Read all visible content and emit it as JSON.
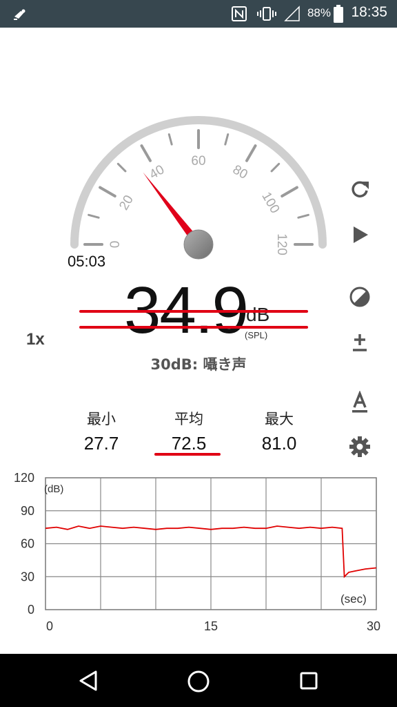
{
  "status_bar": {
    "time": "18:35",
    "battery_percent": "88%",
    "icons": [
      "app-notification-icon",
      "nfc-icon",
      "vibrate-icon",
      "signal-icon",
      "battery-icon"
    ]
  },
  "meter": {
    "gauge_labels": [
      "0",
      "20",
      "40",
      "60",
      "80",
      "100",
      "120"
    ],
    "needle_value": 34.9,
    "elapsed_time": "05:03",
    "reading": "34.9",
    "unit": "dB",
    "unit_sub": "(SPL)",
    "multiplier": "1x",
    "reference": "30dB: 囁き声"
  },
  "stats": {
    "min_label": "最小",
    "min_value": "27.7",
    "avg_label": "平均",
    "avg_value": "72.5",
    "max_label": "最大",
    "max_value": "81.0"
  },
  "side_toolbar": {
    "items": [
      "reset-icon",
      "play-icon",
      "theme-contrast-icon",
      "calibration-plus-minus-icon",
      "font-size-icon",
      "settings-gear-icon"
    ]
  },
  "chart_data": {
    "type": "line",
    "ylabel": "(dB)",
    "xlabel": "(sec)",
    "ylim": [
      0,
      120
    ],
    "xlim": [
      0,
      30
    ],
    "yticks": [
      "120",
      "90",
      "60",
      "30",
      "0"
    ],
    "xticks": [
      "0",
      "15",
      "30"
    ],
    "grid": true,
    "series": [
      {
        "color": "#e00000",
        "x": [
          0,
          1,
          2,
          3,
          4,
          5,
          6,
          7,
          8,
          9,
          10,
          11,
          12,
          13,
          14,
          15,
          16,
          17,
          18,
          19,
          20,
          21,
          22,
          23,
          24,
          25,
          26,
          26.9,
          27.1,
          27.5,
          28,
          29,
          30
        ],
        "y": [
          74,
          75,
          73,
          76,
          74,
          76,
          75,
          74,
          75,
          74,
          73,
          74,
          74,
          75,
          74,
          73,
          74,
          74,
          75,
          74,
          74,
          76,
          75,
          74,
          75,
          74,
          75,
          74,
          30,
          34,
          35,
          37,
          38
        ]
      }
    ]
  },
  "nav_bar": {
    "items": [
      "back-icon",
      "home-icon",
      "recents-icon"
    ]
  }
}
